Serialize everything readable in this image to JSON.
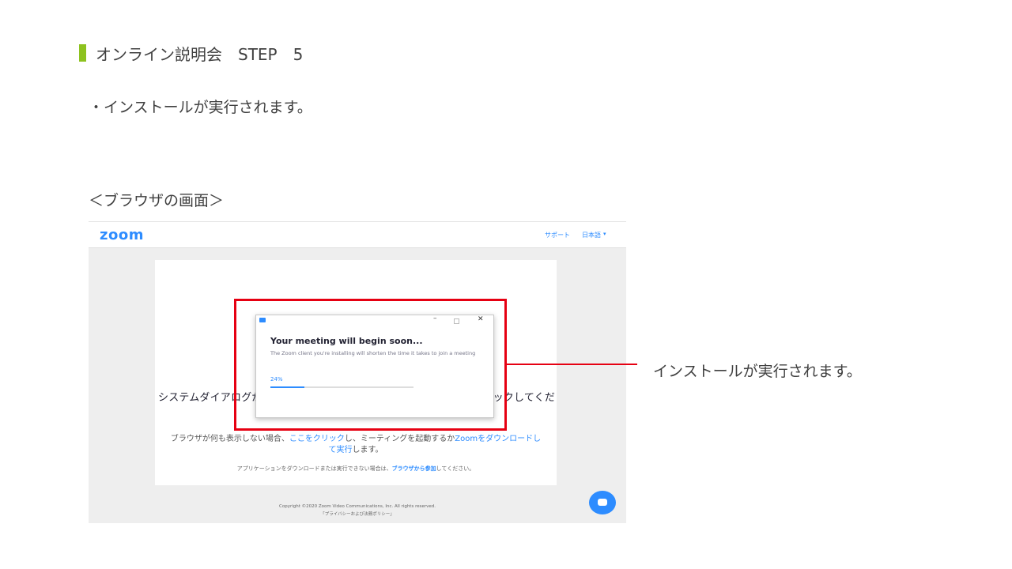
{
  "slide": {
    "title": "オンライン説明会　STEP　5",
    "bullet": "・インストールが実行されます。",
    "section_label": "＜ブラウザの画面＞",
    "callout": "インストールが実行されます。",
    "accent_color": "#8dc21f",
    "highlight_color": "#e60012"
  },
  "browser": {
    "logo": "zoom",
    "nav": {
      "support": "サポート",
      "language": "日本語",
      "language_caret": "▾"
    },
    "dialog_prompt_left": "システムダイアログが",
    "dialog_prompt_right": "ックしてくだ",
    "help": {
      "prefix": "ブラウザが何も表示しない場合、",
      "link1": "ここをクリック",
      "middle": "し、ミーティングを起動するか",
      "link2": "Zoomをダウンロードし",
      "link2_cont": "て実行",
      "suffix": "します。"
    },
    "app_note": {
      "prefix": "アプリケーションをダウンロードまたは実行できない場合は、",
      "link": "ブラウザから参加",
      "suffix": "してください。"
    },
    "copyright": "Copyright ©2020 Zoom Video Communications, Inc. All rights reserved.",
    "privacy": "「プライバシーおよび法務ポリシー」",
    "brand_color": "#2d8cff"
  },
  "installer": {
    "title": "Your meeting will begin soon...",
    "description": "The Zoom client you're installing will shorten the time it takes to join a meeting",
    "progress_label": "24%",
    "progress": 0.24,
    "minimize": "–",
    "close": "✕"
  }
}
